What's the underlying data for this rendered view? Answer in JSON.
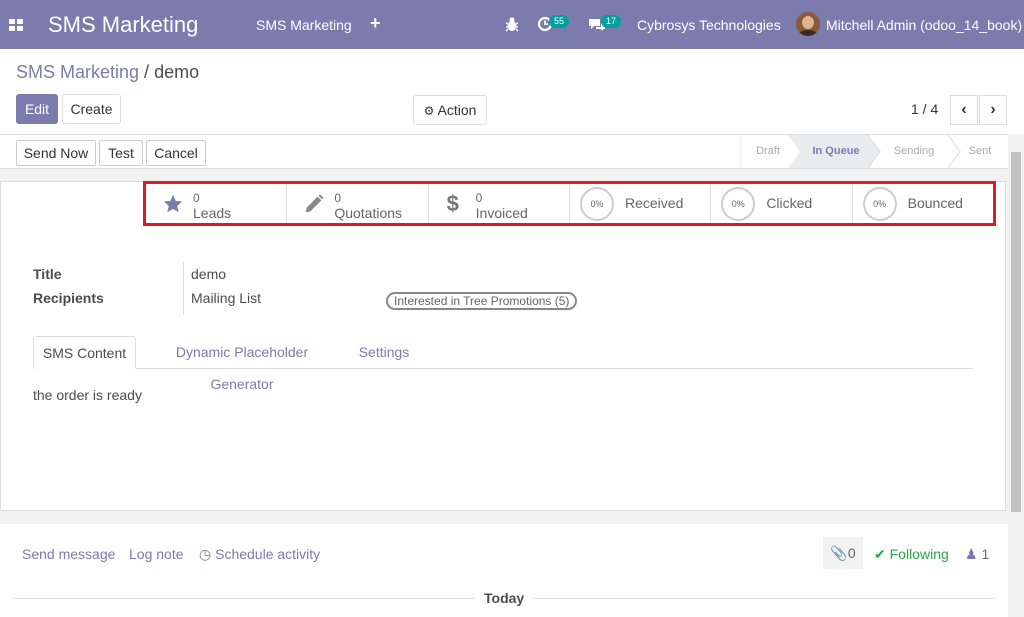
{
  "topbar": {
    "app_title": "SMS Marketing",
    "menu_item": "SMS Marketing",
    "activity_count": "55",
    "message_count": "17",
    "company": "Cybrosys Technologies",
    "user": "Mitchell Admin (odoo_14_book)"
  },
  "breadcrumb": {
    "parent": "SMS Marketing",
    "separator": " / ",
    "current": "demo"
  },
  "control": {
    "edit": "Edit",
    "create": "Create",
    "action": "Action",
    "pager": "1 / 4"
  },
  "statusbar": {
    "send_now": "Send Now",
    "test": "Test",
    "cancel": "Cancel",
    "stages": [
      "Draft",
      "In Queue",
      "Sending",
      "Sent"
    ],
    "active_stage": "In Queue"
  },
  "stats": {
    "leads": {
      "value": "0",
      "label": "Leads"
    },
    "quotations": {
      "value": "0",
      "label": "Quotations"
    },
    "invoiced": {
      "value": "0",
      "label": "Invoiced"
    },
    "received": {
      "pct": "0%",
      "label": "Received"
    },
    "clicked": {
      "pct": "0%",
      "label": "Clicked"
    },
    "bounced": {
      "pct": "0%",
      "label": "Bounced"
    }
  },
  "form": {
    "title_label": "Title",
    "title_value": "demo",
    "recipients_label": "Recipients",
    "recipients_value": "Mailing List",
    "mailing_list_tag": "Interested in Tree Promotions (5)"
  },
  "tabs": [
    "SMS Content",
    "Dynamic Placeholder Generator",
    "Settings"
  ],
  "sms_content": "the order is ready",
  "chatter": {
    "send_message": "Send message",
    "log_note": "Log note",
    "schedule_activity": "Schedule activity",
    "attachments": "0",
    "following": "Following",
    "followers": "1",
    "today": "Today"
  },
  "colors": {
    "brand": "#7c7bad",
    "highlight": "#e01b24",
    "following": "#28a745"
  },
  "icons": [
    "apps-icon",
    "plus-icon",
    "bug-icon",
    "activity-icon",
    "chat-icon",
    "cog-icon",
    "chevron-left-icon",
    "chevron-right-icon",
    "star-icon",
    "pencil-icon",
    "dollar-icon",
    "paperclip-icon",
    "check-icon",
    "user-icon",
    "clock-icon"
  ]
}
